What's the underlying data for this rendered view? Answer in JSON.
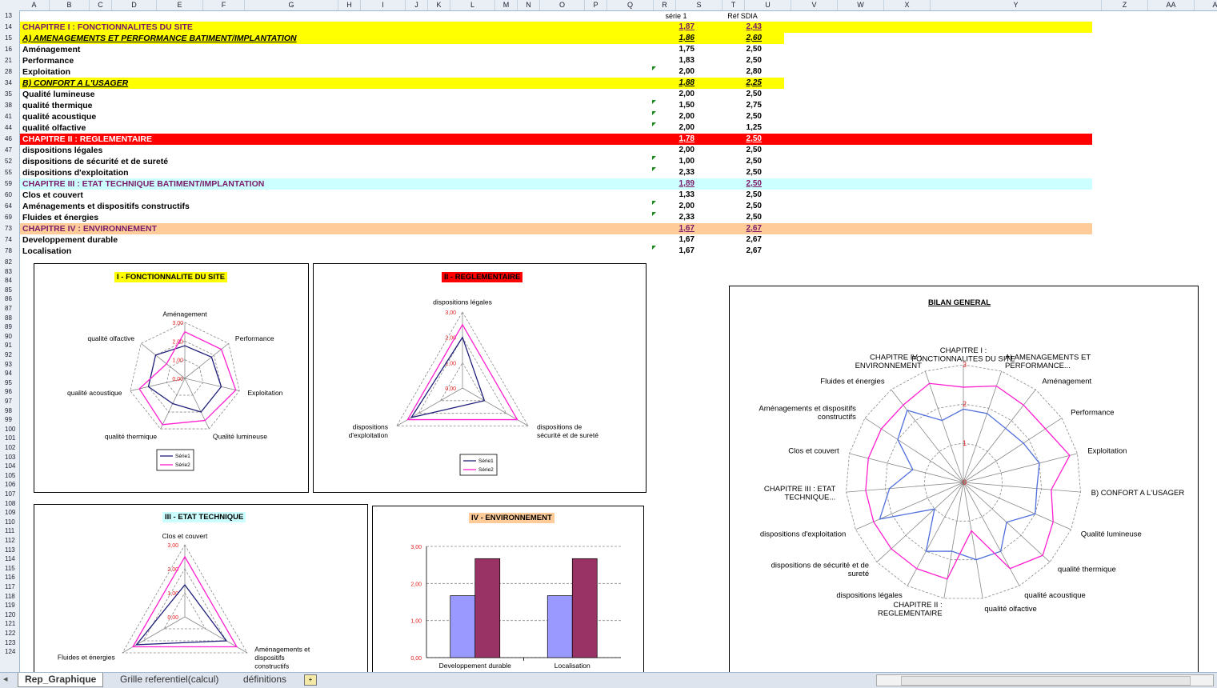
{
  "columns": [
    "A",
    "B",
    "C",
    "D",
    "E",
    "F",
    "G",
    "H",
    "I",
    "J",
    "K",
    "L",
    "M",
    "N",
    "O",
    "P",
    "Q",
    "R",
    "S",
    "T",
    "U",
    "V",
    "W",
    "X",
    "Y",
    "Z",
    "AA",
    "AB"
  ],
  "header_row": {
    "row": "13",
    "serie1": "série 1",
    "ref": "Réf SDIA"
  },
  "rows": [
    {
      "row": "14",
      "label": "CHAPITRE I : FONCTIONNALITES DU SITE",
      "v1": "1,87",
      "v2": "2,43",
      "style": "ch1"
    },
    {
      "row": "15",
      "label": "A) AMENAGEMENTS ET PERFORMANCE BATIMENT/IMPLANTATION",
      "v1": "1,86",
      "v2": "2,60",
      "style": "sub"
    },
    {
      "row": "16",
      "label": "Aménagement",
      "v1": "1,75",
      "v2": "2,50",
      "style": "n"
    },
    {
      "row": "21",
      "label": "Performance",
      "v1": "1,83",
      "v2": "2,50",
      "style": "n"
    },
    {
      "row": "28",
      "label": "Exploitation",
      "v1": "2,00",
      "v2": "2,80",
      "style": "n",
      "flag": true
    },
    {
      "row": "34",
      "label": "B) CONFORT  A L'USAGER",
      "v1": "1,88",
      "v2": "2,25",
      "style": "sub"
    },
    {
      "row": "35",
      "label": "Qualité lumineuse",
      "v1": "2,00",
      "v2": "2,50",
      "style": "n"
    },
    {
      "row": "38",
      "label": "qualité thermique",
      "v1": "1,50",
      "v2": "2,75",
      "style": "n",
      "flag": true
    },
    {
      "row": "41",
      "label": "qualité acoustique",
      "v1": "2,00",
      "v2": "2,50",
      "style": "n",
      "flag": true
    },
    {
      "row": "44",
      "label": "qualité olfactive",
      "v1": "2,00",
      "v2": "1,25",
      "style": "n",
      "flag": true
    },
    {
      "row": "46",
      "label": "CHAPITRE II : REGLEMENTAIRE",
      "v1": "1,78",
      "v2": "2,50",
      "style": "ch2"
    },
    {
      "row": "47",
      "label": "dispositions légales",
      "v1": "2,00",
      "v2": "2,50",
      "style": "n"
    },
    {
      "row": "52",
      "label": "dispositions de sécurité et de sureté",
      "v1": "1,00",
      "v2": "2,50",
      "style": "n",
      "flag": true
    },
    {
      "row": "55",
      "label": "dispositions d'exploitation",
      "v1": "2,33",
      "v2": "2,50",
      "style": "n",
      "flag": true
    },
    {
      "row": "59",
      "label": "CHAPITRE III : ETAT TECHNIQUE BATIMENT/IMPLANTATION",
      "v1": "1,89",
      "v2": "2,50",
      "style": "ch3"
    },
    {
      "row": "60",
      "label": "Clos et couvert",
      "v1": "1,33",
      "v2": "2,50",
      "style": "n"
    },
    {
      "row": "64",
      "label": "Aménagements et dispositifs constructifs",
      "v1": "2,00",
      "v2": "2,50",
      "style": "n",
      "flag": true
    },
    {
      "row": "69",
      "label": "Fluides et énergies",
      "v1": "2,33",
      "v2": "2,50",
      "style": "n",
      "flag": true
    },
    {
      "row": "73",
      "label": "CHAPITRE IV : ENVIRONNEMENT",
      "v1": "1,67",
      "v2": "2,67",
      "style": "ch4"
    },
    {
      "row": "74",
      "label": "Developpement durable",
      "v1": "1,67",
      "v2": "2,67",
      "style": "n"
    },
    {
      "row": "78",
      "label": "Localisation",
      "v1": "1,67",
      "v2": "2,67",
      "style": "n",
      "flag": true
    }
  ],
  "extra_row_numbers": [
    "82",
    "83",
    "84",
    "85",
    "86",
    "87",
    "88",
    "89",
    "90",
    "91",
    "92",
    "93",
    "94",
    "95",
    "96",
    "97",
    "98",
    "99",
    "100",
    "101",
    "102",
    "103",
    "104",
    "105",
    "106",
    "107",
    "108",
    "109",
    "110",
    "111",
    "112",
    "113",
    "114",
    "115",
    "116",
    "117",
    "118",
    "119",
    "120",
    "121",
    "122",
    "123",
    "124"
  ],
  "colors": {
    "serie1": "#1f1f7a",
    "serie2": "#ff1fd0",
    "bilan_serie1": "#4f6fdc",
    "bar1": "#9999ff",
    "bar2": "#993366",
    "yellow": "#ffff00",
    "red": "#ff0000",
    "cyan": "#ccffff",
    "peach": "#ffcc99",
    "green_flag": "#1a8c1a"
  },
  "chart_data": [
    {
      "type": "radar",
      "title": "I - FONCTIONNALITE DU SITE",
      "categories": [
        "Aménagement",
        "Performance",
        "Exploitation",
        "Qualité lumineuse",
        "qualité thermique",
        "qualité acoustique",
        "qualité olfactive"
      ],
      "series": [
        {
          "name": "Série1",
          "values": [
            1.75,
            1.83,
            2.0,
            2.0,
            1.5,
            2.0,
            2.0
          ]
        },
        {
          "name": "Série2",
          "values": [
            2.5,
            2.5,
            2.8,
            2.5,
            2.75,
            2.5,
            1.25
          ]
        }
      ],
      "ticks": [
        "0,00",
        "1,00",
        "2,00",
        "3,00"
      ],
      "rlim": [
        0,
        3
      ],
      "legend": "bottom"
    },
    {
      "type": "radar",
      "title": "II - REGLEMENTAIRE",
      "categories": [
        "dispositions légales",
        "dispositions de sécurité et de sureté",
        "dispositions d'exploitation"
      ],
      "series": [
        {
          "name": "Série1",
          "values": [
            2.0,
            1.0,
            2.33
          ]
        },
        {
          "name": "Série2",
          "values": [
            2.5,
            2.5,
            2.5
          ]
        }
      ],
      "ticks": [
        "0,00",
        "1,00",
        "2,00",
        "3,00"
      ],
      "rlim": [
        0,
        3
      ],
      "legend": "bottom"
    },
    {
      "type": "radar",
      "title": "III - ETAT  TECHNIQUE",
      "categories": [
        "Clos et couvert",
        "Aménagements et dispositifs constructifs",
        "Fluides et énergies"
      ],
      "series": [
        {
          "values": [
            1.33,
            2.0,
            2.33
          ]
        },
        {
          "values": [
            2.5,
            2.5,
            2.5
          ]
        }
      ],
      "ticks": [
        "0,00",
        "1,00",
        "2,00",
        "3,00"
      ],
      "rlim": [
        0,
        3
      ]
    },
    {
      "type": "bar",
      "title": "IV - ENVIRONNEMENT",
      "categories": [
        "Developpement durable",
        "Localisation"
      ],
      "series": [
        {
          "values": [
            1.67,
            1.67
          ]
        },
        {
          "values": [
            2.67,
            2.67
          ]
        }
      ],
      "ticks": [
        "0,00",
        "1,00",
        "2,00",
        "3,00"
      ],
      "ylim": [
        0,
        3
      ]
    },
    {
      "type": "radar",
      "title": "BILAN GENERAL",
      "categories": [
        "CHAPITRE I : FONCTIONNALITES DU SITE",
        "A) AMENAGEMENTS ET PERFORMANCE...",
        "Aménagement",
        "Performance",
        "Exploitation",
        "B) CONFORT  A L'USAGER",
        "Qualité lumineuse",
        "qualité thermique",
        "qualité acoustique",
        "qualité olfactive",
        "CHAPITRE II : REGLEMENTAIRE",
        "dispositions légales",
        "dispositions de sécurité et de sureté",
        "dispositions d'exploitation",
        "CHAPITRE III : ETAT TECHNIQUE...",
        "Clos et couvert",
        "Aménagements et dispositifs constructifs",
        "Fluides et énergies",
        "CHAPITRE IV : ENVIRONNEMENT"
      ],
      "series": [
        {
          "values": [
            1.87,
            1.86,
            1.75,
            1.83,
            2.0,
            1.88,
            2.0,
            1.5,
            2.0,
            2.0,
            1.78,
            2.0,
            1.0,
            2.33,
            1.89,
            1.33,
            2.0,
            2.33,
            1.67
          ]
        },
        {
          "values": [
            2.43,
            2.6,
            2.5,
            2.5,
            2.8,
            2.25,
            2.5,
            2.75,
            2.5,
            1.25,
            2.5,
            2.5,
            2.5,
            2.5,
            2.5,
            2.5,
            2.5,
            2.5,
            2.67
          ]
        }
      ],
      "ticks": [
        "0",
        "1",
        "2",
        "3"
      ],
      "rlim": [
        0,
        3
      ]
    }
  ],
  "tabs": [
    "Rep_Graphique",
    "Grille referentiel(calcul)",
    "définitions"
  ]
}
